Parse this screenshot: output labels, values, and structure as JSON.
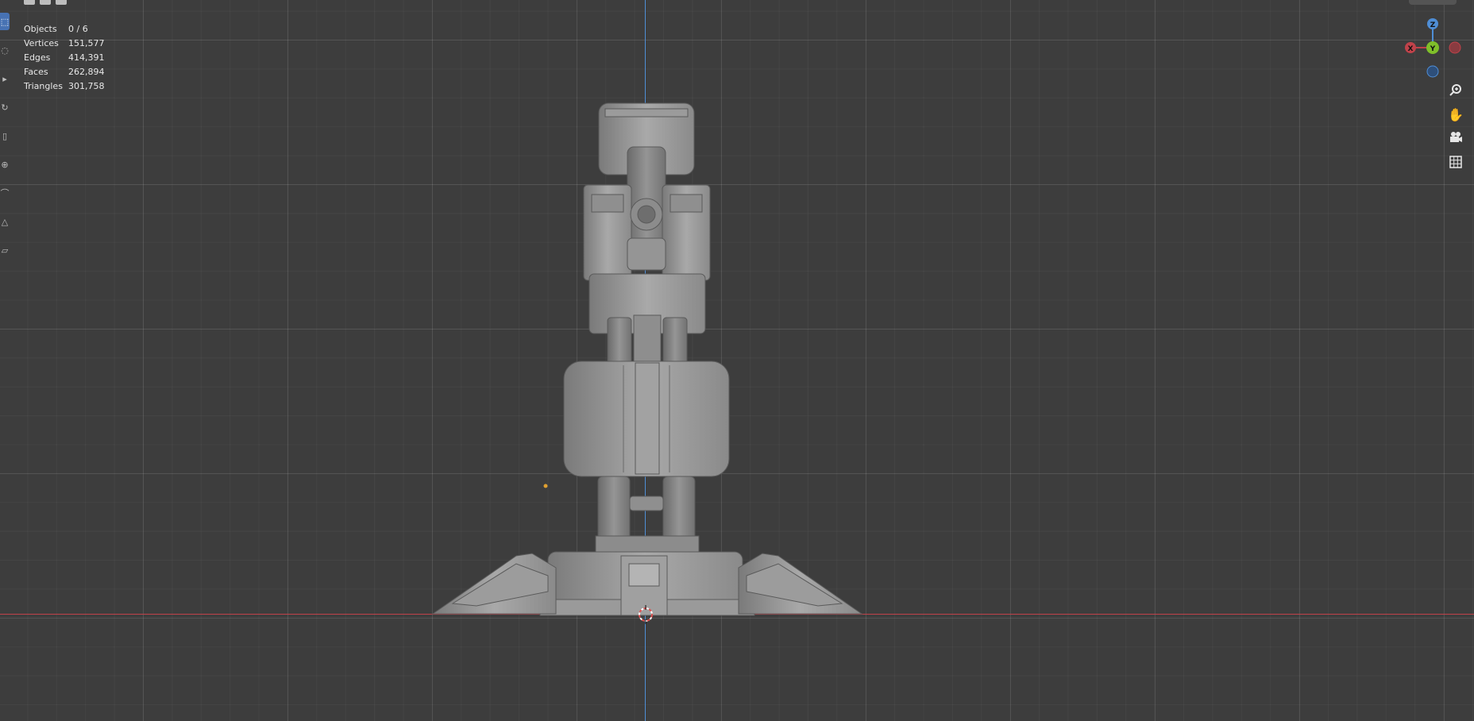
{
  "stats": [
    {
      "label": "Objects",
      "value": "0 / 6"
    },
    {
      "label": "Vertices",
      "value": "151,577"
    },
    {
      "label": "Edges",
      "value": "414,391"
    },
    {
      "label": "Faces",
      "value": "262,894"
    },
    {
      "label": "Triangles",
      "value": "301,758"
    }
  ],
  "gizmo": {
    "z": "Z",
    "y": "Y",
    "x": "X"
  },
  "colors": {
    "x_axis": "#c0424a",
    "y_axis": "#7fbf2a",
    "z_axis": "#4f8ed6",
    "active_tool": "#4772b3"
  },
  "nav_icons": [
    "zoom-icon",
    "hand-pan-icon",
    "camera-icon",
    "grid-icon"
  ]
}
